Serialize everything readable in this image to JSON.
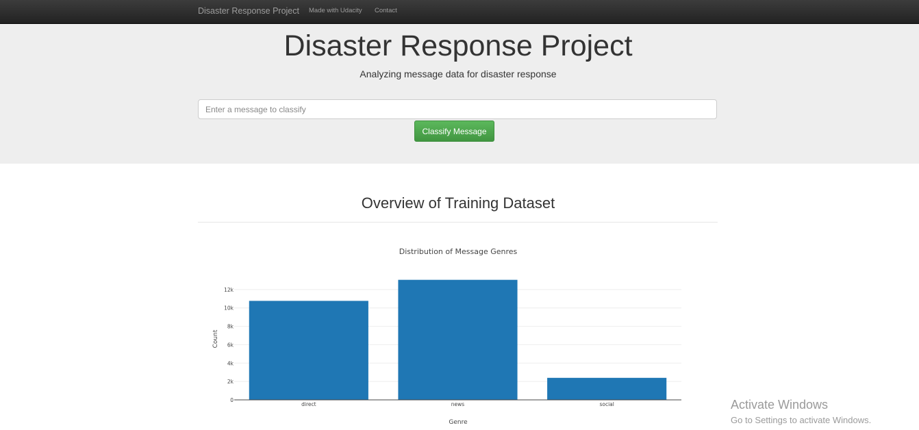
{
  "navbar": {
    "brand": "Disaster Response Project",
    "links": [
      "Made with Udacity",
      "Contact"
    ]
  },
  "jumbotron": {
    "title": "Disaster Response Project",
    "subtitle": "Analyzing message data for disaster response",
    "input_placeholder": "Enter a message to classify",
    "input_value": "",
    "button_label": "Classify Message"
  },
  "overview": {
    "title": "Overview of Training Dataset"
  },
  "chart_data": {
    "type": "bar",
    "title": "Distribution of Message Genres",
    "xlabel": "Genre",
    "ylabel": "Count",
    "categories": [
      "direct",
      "news",
      "social"
    ],
    "values": [
      10766,
      13054,
      2396
    ],
    "ylim": [
      0,
      13700
    ],
    "yticks": [
      0,
      2000,
      4000,
      6000,
      8000,
      10000,
      12000
    ],
    "ytick_labels": [
      "0",
      "2k",
      "4k",
      "6k",
      "8k",
      "10k",
      "12k"
    ],
    "grid": true,
    "bar_color": "#1f77b4"
  },
  "watermark": {
    "line1": "Activate Windows",
    "line2": "Go to Settings to activate Windows."
  }
}
